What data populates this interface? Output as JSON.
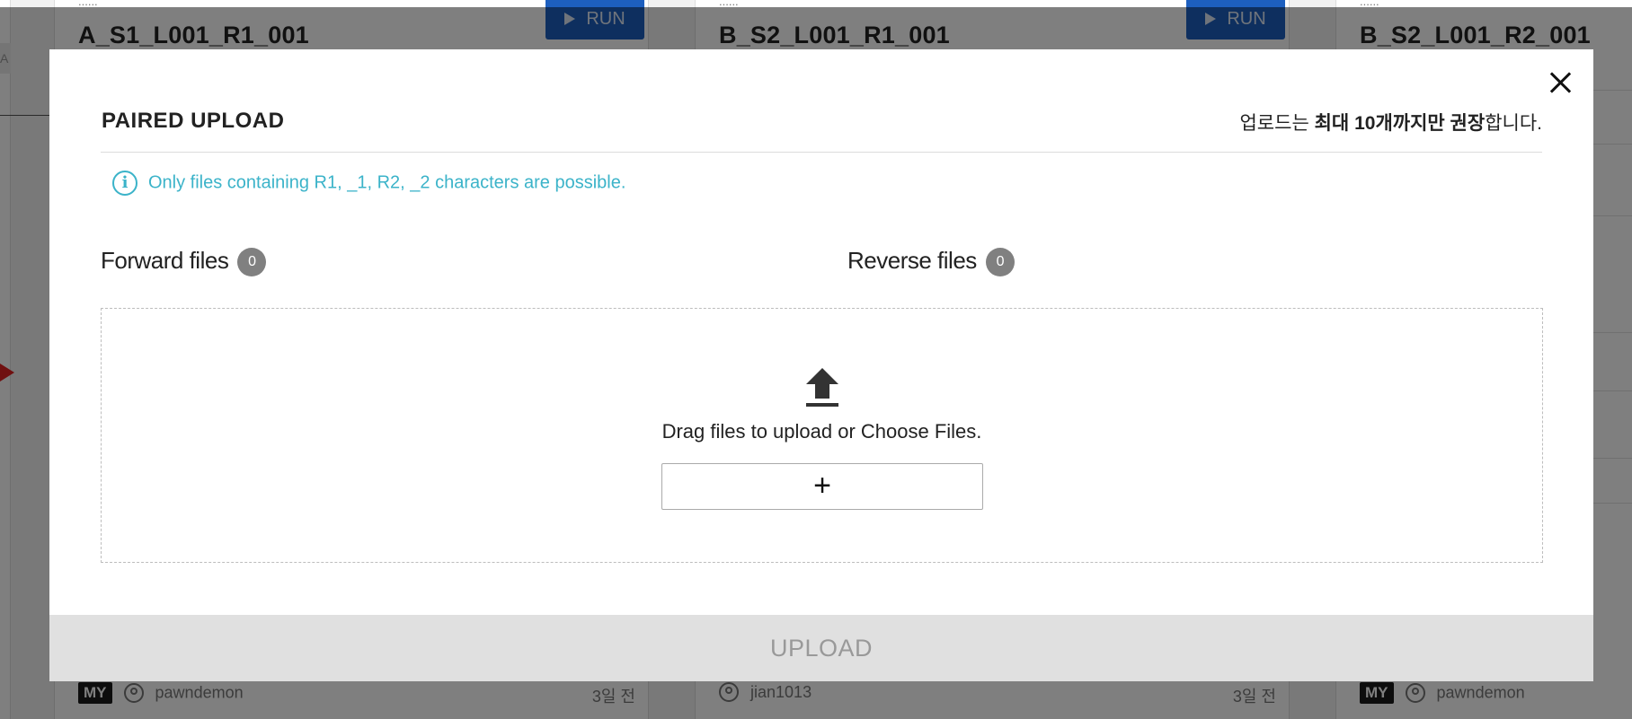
{
  "background": {
    "left_label": "A",
    "cards": [
      {
        "subtitle": "......",
        "title": "A_S1_L001_R1_001",
        "run_label": "RUN",
        "my_badge": "MY",
        "user": "pawndemon",
        "time": "3일 전"
      },
      {
        "subtitle": "......",
        "title": "B_S2_L001_R1_001",
        "run_label": "RUN",
        "my_badge": "",
        "user": "jian1013",
        "time": "3일 전"
      },
      {
        "subtitle": "......",
        "title": "B_S2_L001_R2_001",
        "run_label": "",
        "my_badge": "MY",
        "user": "pawndemon",
        "time": ""
      }
    ]
  },
  "modal": {
    "title": "PAIRED UPLOAD",
    "notice_prefix": "업로드는 ",
    "notice_bold": "최대 10개까지만 권장",
    "notice_suffix": "합니다.",
    "info_icon": "i",
    "info_prefix": "Only files containing ",
    "info_highlight": "R1, _1, R2, _2",
    "info_suffix": " characters are possible.",
    "forward_label": "Forward files",
    "forward_count": "0",
    "reverse_label": "Reverse files",
    "reverse_count": "0",
    "drop_text": "Drag files to upload or Choose Files.",
    "choose_button": "+",
    "upload_button": "UPLOAD",
    "close_icon": "close-icon",
    "upload_icon": "upload-icon"
  },
  "colors": {
    "accent_info": "#3bb3c9",
    "run_button": "#1d5fbf",
    "badge_gray": "#808080",
    "upload_disabled": "#e0e0e0"
  }
}
